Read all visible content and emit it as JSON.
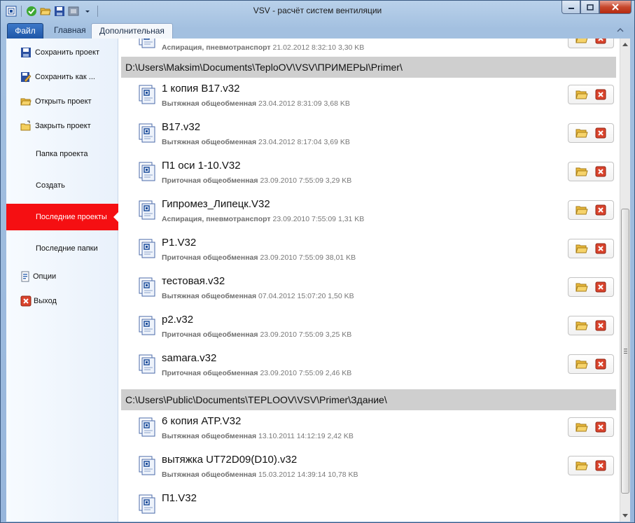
{
  "window": {
    "title": "VSV - расчёт систем вентиляции"
  },
  "ribbon": {
    "tabs": [
      "Файл",
      "Главная",
      "Дополнительная"
    ]
  },
  "nav": {
    "items": [
      {
        "label": "Сохранить проект",
        "icon": "save-icon"
      },
      {
        "label": "Сохранить как ...",
        "icon": "save-as-icon"
      },
      {
        "label": "Открыть проект",
        "icon": "open-folder-icon"
      },
      {
        "label": "Закрыть проект",
        "icon": "close-folder-icon"
      },
      {
        "label": "Папка проекта",
        "icon": ""
      },
      {
        "label": "Создать",
        "icon": ""
      },
      {
        "label": "Последние проекты",
        "icon": ""
      },
      {
        "label": "Последние папки",
        "icon": ""
      },
      {
        "label": "Опции",
        "icon": "options-icon"
      },
      {
        "label": "Выход",
        "icon": "exit-icon"
      }
    ],
    "selected": "Последние проекты"
  },
  "recent": {
    "top_partial": {
      "type": "Аспирация, пневмотранспорт",
      "date": "21.02.2012 8:32:10",
      "size": "3,30 KB"
    },
    "groups": [
      {
        "path": "D:\\Users\\Maksim\\Documents\\TeploOV\\VSV\\ПРИМЕРЫ\\Primer\\",
        "items": [
          {
            "name": "1 копия B17.v32",
            "type": "Вытяжная общеобменная",
            "date": "23.04.2012 8:31:09",
            "size": "3,68 KB"
          },
          {
            "name": "B17.v32",
            "type": "Вытяжная общеобменная",
            "date": "23.04.2012 8:17:04",
            "size": "3,69 KB"
          },
          {
            "name": "П1 оси 1-10.V32",
            "type": "Приточная общеобменная",
            "date": "23.09.2010 7:55:09",
            "size": "3,29 KB"
          },
          {
            "name": "Гипромез_Липецк.V32",
            "type": "Аспирация, пневмотранспорт",
            "date": "23.09.2010 7:55:09",
            "size": "1,31 KB"
          },
          {
            "name": "P1.V32",
            "type": "Приточная общеобменная",
            "date": "23.09.2010 7:55:09",
            "size": "38,01 KB"
          },
          {
            "name": "тестовая.v32",
            "type": "Вытяжная общеобменная",
            "date": "07.04.2012 15:07:20",
            "size": "1,50 KB"
          },
          {
            "name": "p2.v32",
            "type": "Приточная общеобменная",
            "date": "23.09.2010 7:55:09",
            "size": "3,25 KB"
          },
          {
            "name": "samara.v32",
            "type": "Приточная общеобменная",
            "date": "23.09.2010 7:55:09",
            "size": "2,46 KB"
          }
        ]
      },
      {
        "path": "C:\\Users\\Public\\Documents\\TEPLOOV\\VSV\\Primer\\Здание\\",
        "items": [
          {
            "name": "6 копия ATP.V32",
            "type": "Вытяжная общеобменная",
            "date": "13.10.2011 14:12:19",
            "size": "2,42 KB"
          },
          {
            "name": "вытяжка UT72D09(D10).v32",
            "type": "Вытяжная общеобменная",
            "date": "15.03.2012 14:39:14",
            "size": "10,78 KB"
          },
          {
            "name": "П1.V32",
            "type": "",
            "date": "",
            "size": ""
          }
        ]
      }
    ]
  },
  "colors": {
    "selected_nav": "#f50f12",
    "file_tab": "#2a62b4",
    "group_header": "#cfcfcf"
  }
}
